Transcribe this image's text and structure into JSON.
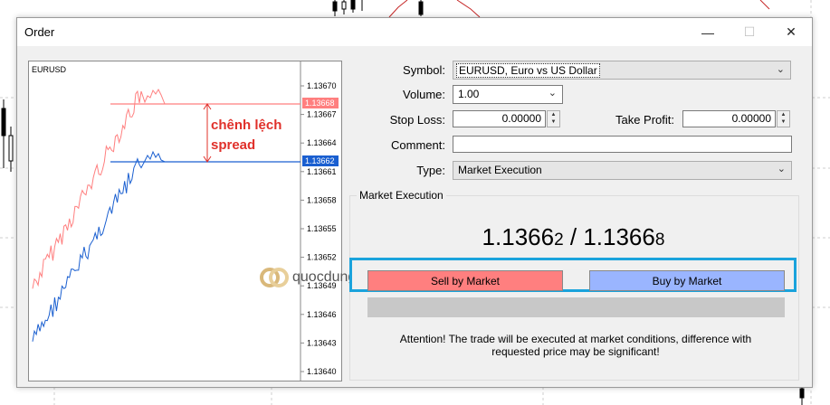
{
  "window": {
    "title": "Order"
  },
  "chart": {
    "symbol": "EURUSD",
    "y_ticks": [
      "1.13670",
      "1.13667",
      "1.13664",
      "1.13661",
      "1.13658",
      "1.13655",
      "1.13652",
      "1.13649",
      "1.13646",
      "1.13643",
      "1.13640"
    ],
    "ask_tag": "1.13668",
    "bid_tag": "1.13662",
    "ask_color": "#ff7f7f",
    "bid_color": "#1a5fd0"
  },
  "annotation": {
    "line1": "chênh lệch",
    "line2": "spread"
  },
  "form": {
    "symbol_label": "Symbol:",
    "symbol_value": "EURUSD, Euro vs US Dollar",
    "volume_label": "Volume:",
    "volume_value": "1.00",
    "stop_loss_label": "Stop Loss:",
    "stop_loss_value": "0.00000",
    "take_profit_label": "Take Profit:",
    "take_profit_value": "0.00000",
    "comment_label": "Comment:",
    "comment_value": "",
    "type_label": "Type:",
    "type_value": "Market Execution"
  },
  "market": {
    "group_title": "Market Execution",
    "bid_main": "1.1366",
    "bid_small": "2",
    "separator": " / ",
    "ask_main": "1.1366",
    "ask_small": "8",
    "sell_label": "Sell by Market",
    "buy_label": "Buy by Market",
    "attention": "Attention! The trade will be executed at market conditions, difference with requested price may be significant!"
  },
  "watermark": {
    "text": "quocdunginvest"
  },
  "icons": {
    "close": "close-icon",
    "maximize": "maximize-icon",
    "minimize": "minimize-icon",
    "dropdown": "chevron-down-icon"
  }
}
